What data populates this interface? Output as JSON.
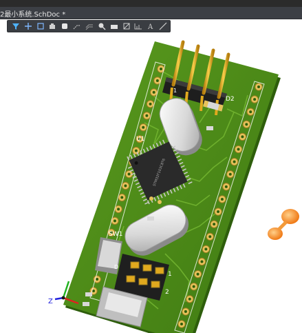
{
  "tab": {
    "title": "2最小系统.SchDoc *"
  },
  "toolbar": {
    "tools": [
      "filter-icon",
      "crosshair-icon",
      "select-rect-icon",
      "place-component-icon",
      "place-pad-icon",
      "interactive-route-icon",
      "diff-pair-icon",
      "place-via-icon",
      "polygon-fill-icon",
      "region-icon",
      "dimension-icon",
      "text-icon",
      "line-icon"
    ]
  },
  "pcb": {
    "designators": {
      "connector": "1",
      "led": "D2",
      "mcu": "U1",
      "switch": "SW1",
      "header_pin1": "1",
      "header_pin2": "2",
      "diode": "D"
    },
    "chip_marking": "STM32F103C8T6",
    "colors": {
      "board": "#4c8a18",
      "board_dark": "#2e5e0c",
      "trace": "#6cad2a",
      "pad": "#e6c25a",
      "silkscreen": "#ffffff",
      "gold_pin": "#e0a91e",
      "toolbar": "#3a3d42"
    }
  },
  "axes": {
    "x": "",
    "y": "",
    "z": "Z"
  }
}
